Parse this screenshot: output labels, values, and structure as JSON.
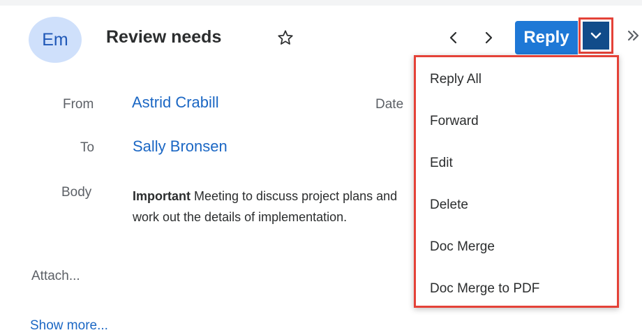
{
  "record": {
    "avatar_initials": "Em",
    "title": "Review needs"
  },
  "actions": {
    "reply_label": "Reply",
    "more_symbol": "»"
  },
  "fields": {
    "from_label": "From",
    "from_value": "Astrid Crabill",
    "date_label": "Date",
    "to_label": "To",
    "to_value": "Sally Bronsen",
    "body_label": "Body",
    "body_bold": "Important",
    "body_text": " Meeting to discuss project plans and work out the details of implementation."
  },
  "attach_label": "Attach...",
  "show_more_label": "Show more...",
  "dropdown": {
    "items": [
      {
        "label": "Reply All"
      },
      {
        "label": "Forward"
      },
      {
        "label": "Edit"
      },
      {
        "label": "Delete"
      },
      {
        "label": "Doc Merge"
      },
      {
        "label": "Doc Merge to PDF"
      }
    ]
  },
  "colors": {
    "primary_button": "#1e78d6",
    "caret_button": "#114c8a",
    "link": "#1b67c4",
    "highlight_border": "#e44238",
    "avatar_bg": "#cfe0fb"
  },
  "icons": {
    "star": "star-outline-icon",
    "prev": "chevron-left-icon",
    "next": "chevron-right-icon",
    "caret": "chevron-down-icon",
    "more": "double-chevron-right-icon"
  }
}
